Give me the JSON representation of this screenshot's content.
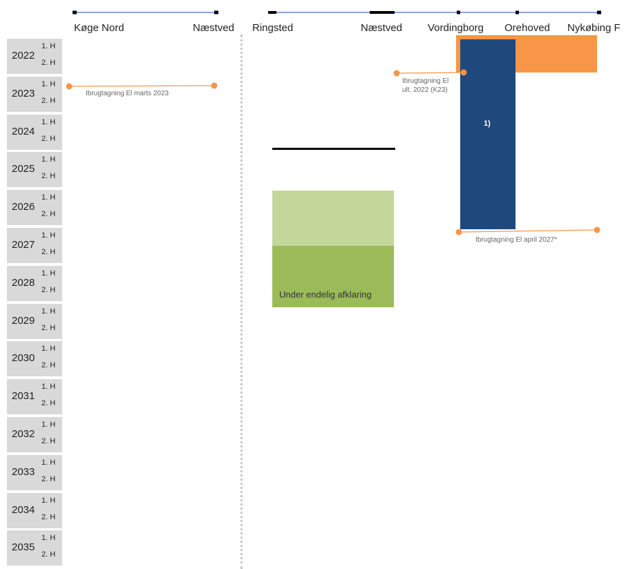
{
  "left_section": {
    "stations": [
      "Køge Nord",
      "Næstved"
    ],
    "event": {
      "label": "Ibrugtagning El  marts 2023"
    }
  },
  "right_section": {
    "stations": [
      "Ringsted",
      "Næstved",
      "Vordingborg",
      "Orehoved",
      "Nykøbing F"
    ],
    "green_block": {
      "label": "Under endelig afklaring"
    },
    "blue_block": {
      "label": "1)"
    },
    "event_vordingborg": {
      "line1": "Ibrugtagning El",
      "line2": "ult. 2022 (K23)"
    },
    "event_orehoved": {
      "label": "Ibrugtagning El  april 2027*"
    }
  },
  "timeline": {
    "years": [
      "2022",
      "2023",
      "2024",
      "2025",
      "2026",
      "2027",
      "2028",
      "2029",
      "2030",
      "2031",
      "2032",
      "2033",
      "2034",
      "2035"
    ],
    "half1": "1. H",
    "half2": "2. H"
  },
  "colors": {
    "track_line": "#4472c4",
    "orange": "#f79646",
    "dark_blue": "#1f497d",
    "green_light": "#c4d79b",
    "green_dark": "#9bbb59",
    "year_bg": "#d9d9d9",
    "divider": "#c8c8c8"
  }
}
